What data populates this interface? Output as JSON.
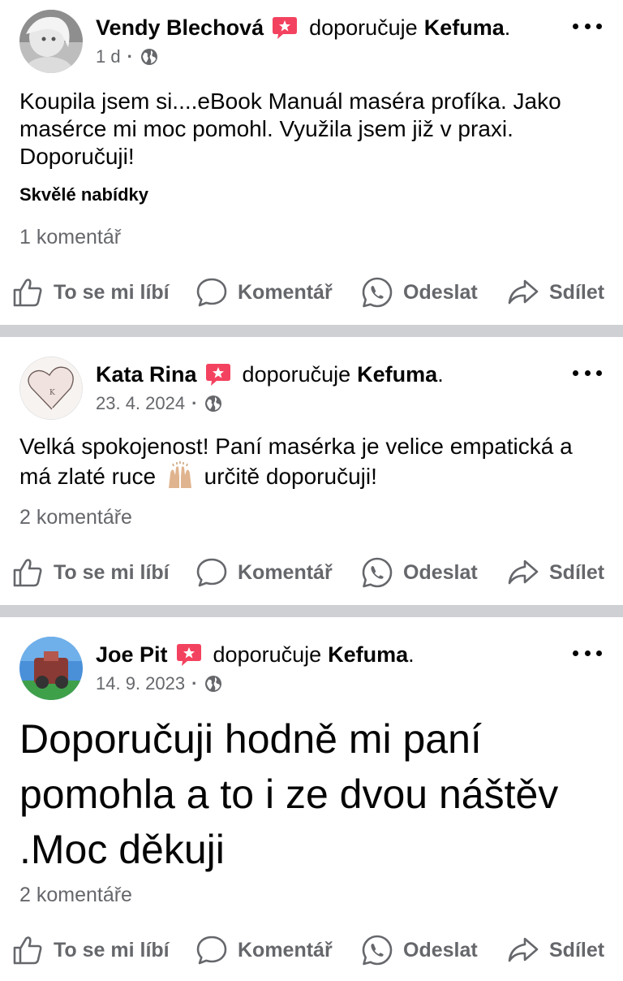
{
  "recommend_word": "doporučuje",
  "page_name": "Kefuma",
  "actions": {
    "like": "To se mi líbí",
    "comment": "Komentář",
    "send": "Odeslat",
    "share": "Sdílet"
  },
  "posts": [
    {
      "author": "Vendy Blechová",
      "date": "1 d",
      "text": "Koupila jsem si....eBook Manuál maséra profíka. Jako masérce mi moc pomohl. Využila jsem již v praxi. Doporučuji!",
      "tag": "Skvělé nabídky",
      "comments": "1 komentář"
    },
    {
      "author": "Kata Rina",
      "date": "23. 4. 2024",
      "text_before": "Velká spokojenost! Paní masérka je velice empatická a má zlaté ruce",
      "text_after": "určitě doporučuji!",
      "comments": "2 komentáře"
    },
    {
      "author": "Joe Pit",
      "date": "14. 9. 2023",
      "text": "Doporučuji hodně mi paní pomohla a to i ze dvou náštěv .Moc děkuji",
      "comments": "2 komentáře"
    }
  ],
  "colors": {
    "badge": "#f3425f",
    "secondary_text": "#65676b",
    "divider": "#ced0d4"
  }
}
